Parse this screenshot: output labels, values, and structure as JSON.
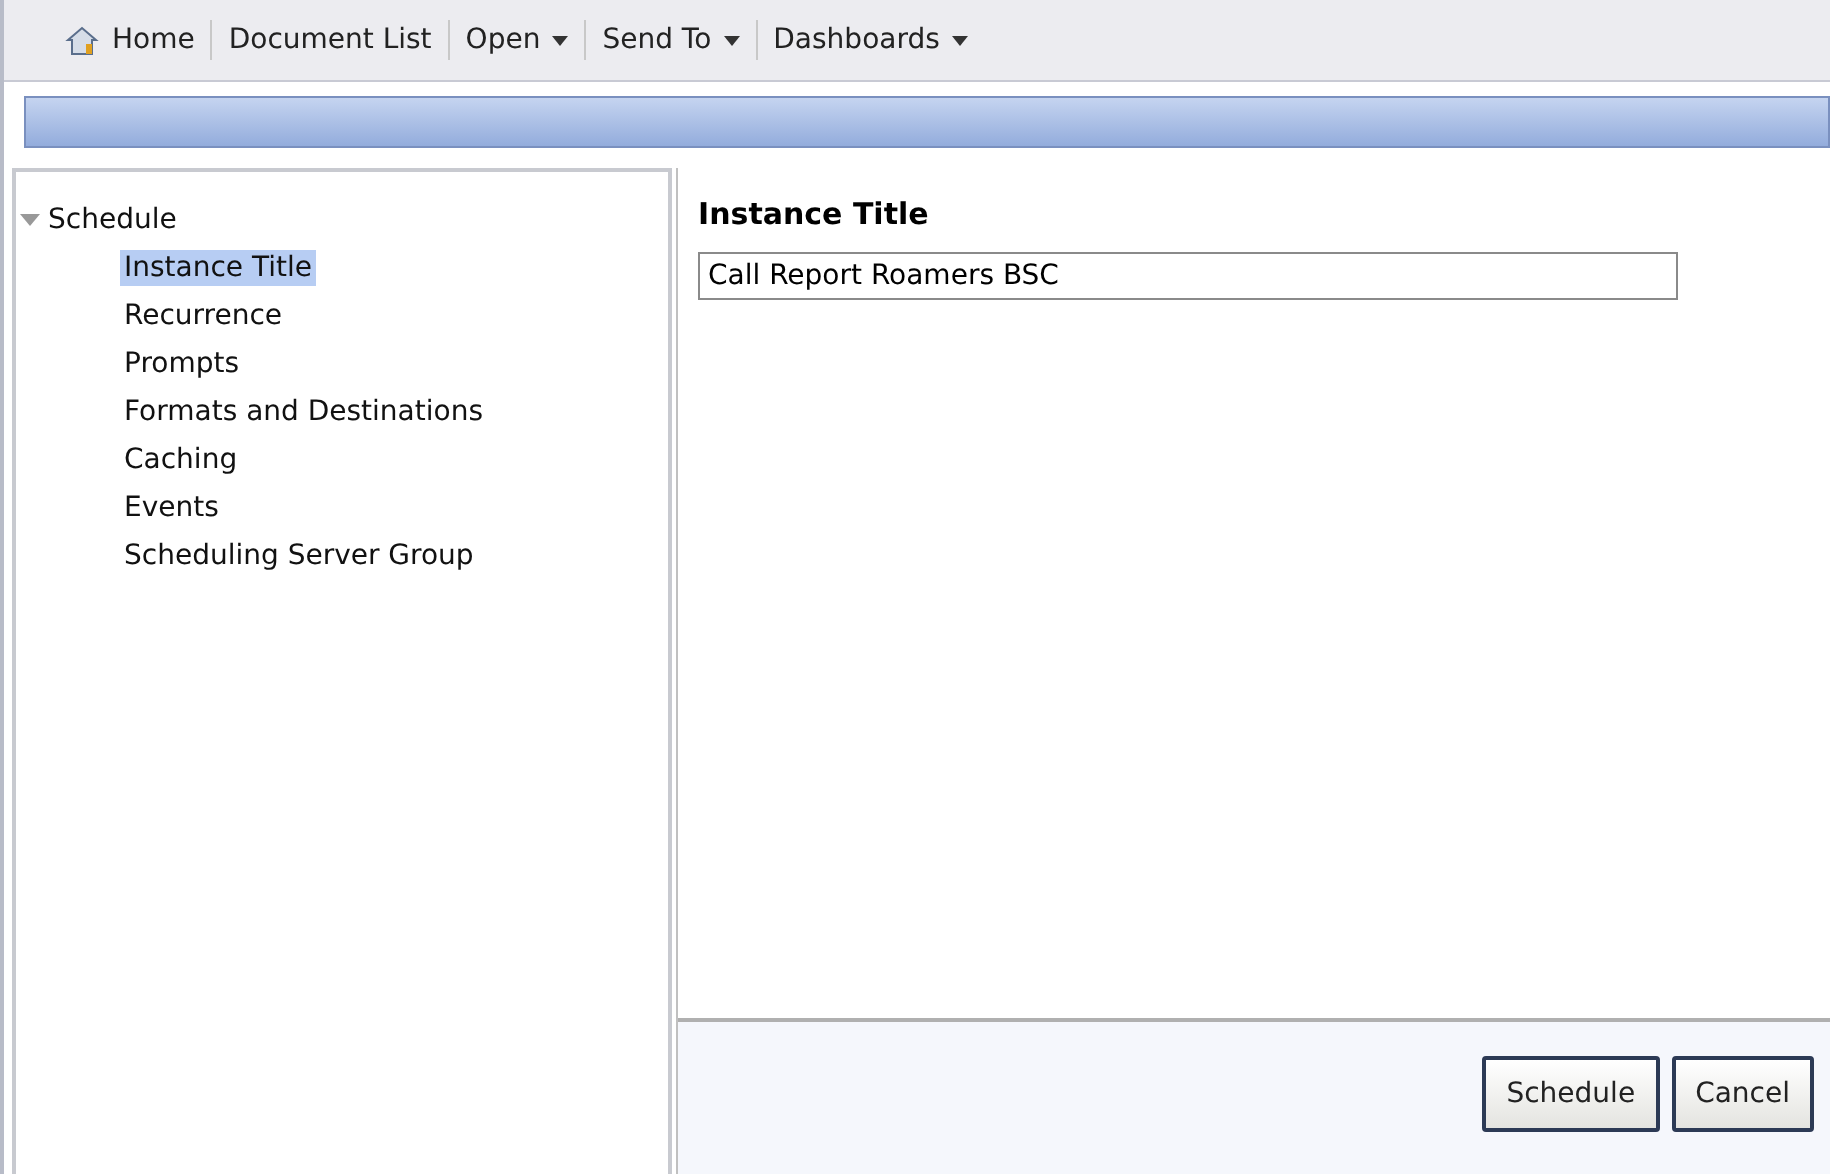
{
  "toolbar": [
    {
      "label": "Home",
      "kind": "home"
    },
    {
      "label": "Document List",
      "kind": "link"
    },
    {
      "label": "Open",
      "kind": "menu"
    },
    {
      "label": "Send To",
      "kind": "menu"
    },
    {
      "label": "Dashboards",
      "kind": "menu"
    }
  ],
  "tree": {
    "label": "Schedule",
    "expanded": true,
    "children": [
      {
        "label": "Instance Title",
        "selected": true
      },
      {
        "label": "Recurrence",
        "selected": false
      },
      {
        "label": "Prompts",
        "selected": false
      },
      {
        "label": "Formats and Destinations",
        "selected": false
      },
      {
        "label": "Caching",
        "selected": false
      },
      {
        "label": "Events",
        "selected": false
      },
      {
        "label": "Scheduling Server Group",
        "selected": false
      }
    ]
  },
  "content": {
    "heading": "Instance Title",
    "title_field": {
      "value": "Call Report Roamers BSC"
    }
  },
  "buttons": [
    "Schedule",
    "Cancel"
  ]
}
